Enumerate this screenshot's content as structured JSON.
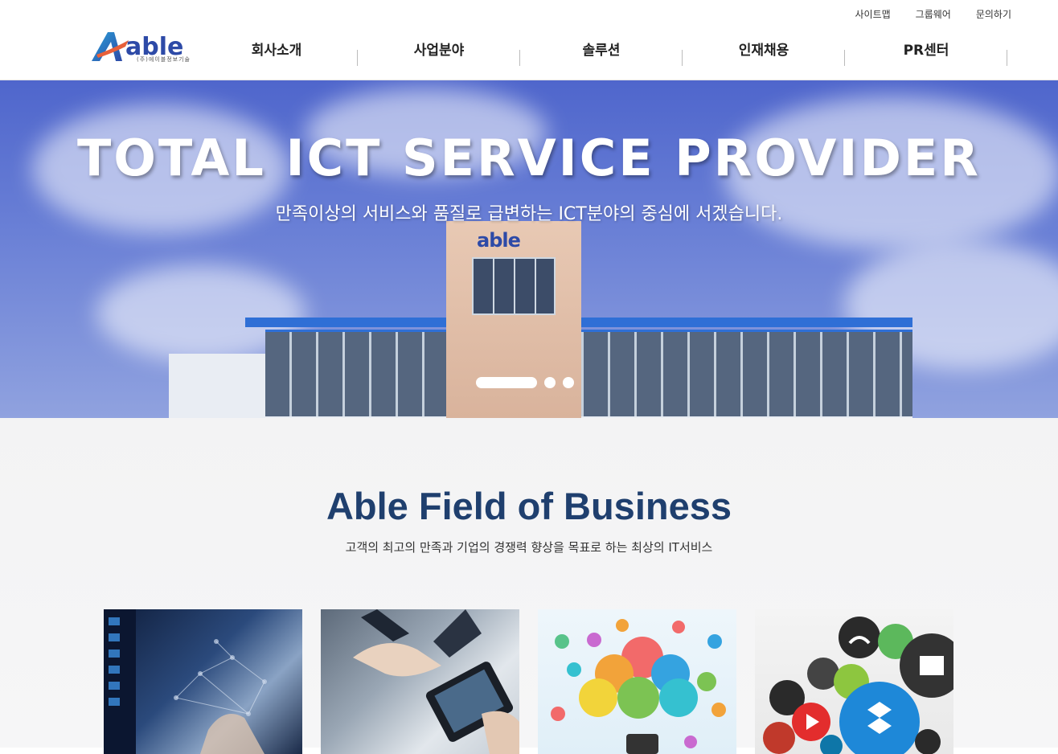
{
  "header": {
    "util_links": [
      "사이트맵",
      "그룹웨어",
      "문의하기"
    ],
    "logo": {
      "text": "able",
      "sub": "(주)에이블정보기술",
      "brand_color": "#2d4aa7"
    },
    "nav": [
      "회사소개",
      "사업분야",
      "솔루션",
      "인재채용",
      "PR센터"
    ]
  },
  "hero": {
    "title": "TOTAL ICT SERVICE PROVIDER",
    "subtitle": "만족이상의 서비스와 품질로 급변하는 ICT분야의 중심에 서겠습니다.",
    "building_sign": "able",
    "slides": {
      "count": 3,
      "active": 1
    }
  },
  "business": {
    "title": "Able Field of Business",
    "subtitle": "고객의 최고의 만족과 기업의 경쟁력 향상을 목표로 하는 최상의 IT서비스",
    "title_color": "#1f3f6e",
    "cards": [
      {
        "image": "global-network-image"
      },
      {
        "image": "handshake-tablet-image"
      },
      {
        "image": "cloud-icons-image"
      },
      {
        "image": "app-icons-image"
      }
    ]
  }
}
